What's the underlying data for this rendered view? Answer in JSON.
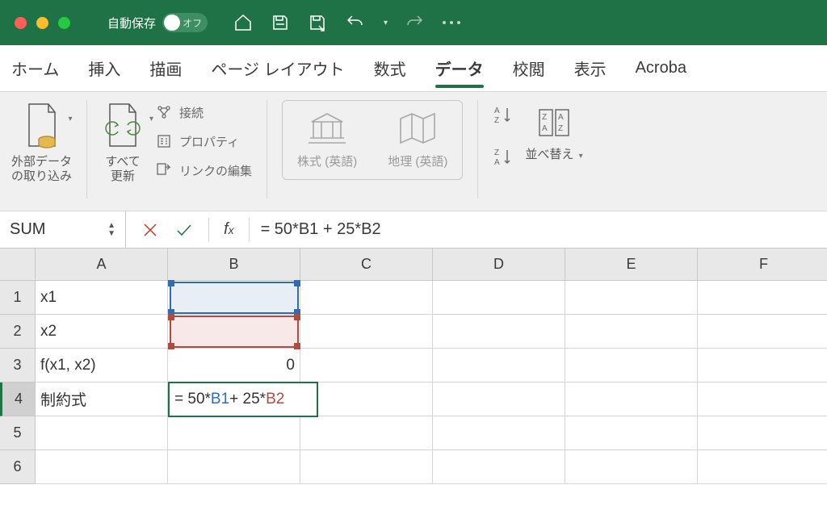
{
  "autosave": {
    "label": "自動保存",
    "state": "オフ"
  },
  "tabs": {
    "home": "ホーム",
    "insert": "挿入",
    "draw": "描画",
    "layout": "ページ レイアウト",
    "formulas": "数式",
    "data": "データ",
    "review": "校閲",
    "view": "表示",
    "acrobat": "Acroba"
  },
  "ribbon": {
    "external": {
      "line1": "外部データ",
      "line2": "の取り込み"
    },
    "refresh": {
      "line1": "すべて",
      "line2": "更新"
    },
    "connections": "接続",
    "properties": "プロパティ",
    "editlinks": "リンクの編集",
    "stocks": "株式 (英語)",
    "geo": "地理 (英語)",
    "sort": "並べ替え"
  },
  "formula_bar": {
    "namebox": "SUM",
    "formula": "= 50*B1 + 25*B2"
  },
  "columns": [
    "A",
    "B",
    "C",
    "D",
    "E",
    "F"
  ],
  "rows": [
    "1",
    "2",
    "3",
    "4",
    "5",
    "6"
  ],
  "cells": {
    "A1": "x1",
    "A2": "x2",
    "A3": "f(x1, x2)",
    "A4": "制約式",
    "B3": "0"
  },
  "edit": {
    "pre": "= 50*",
    "ref1": "B1",
    "mid": " + 25*",
    "ref2": "B2"
  }
}
